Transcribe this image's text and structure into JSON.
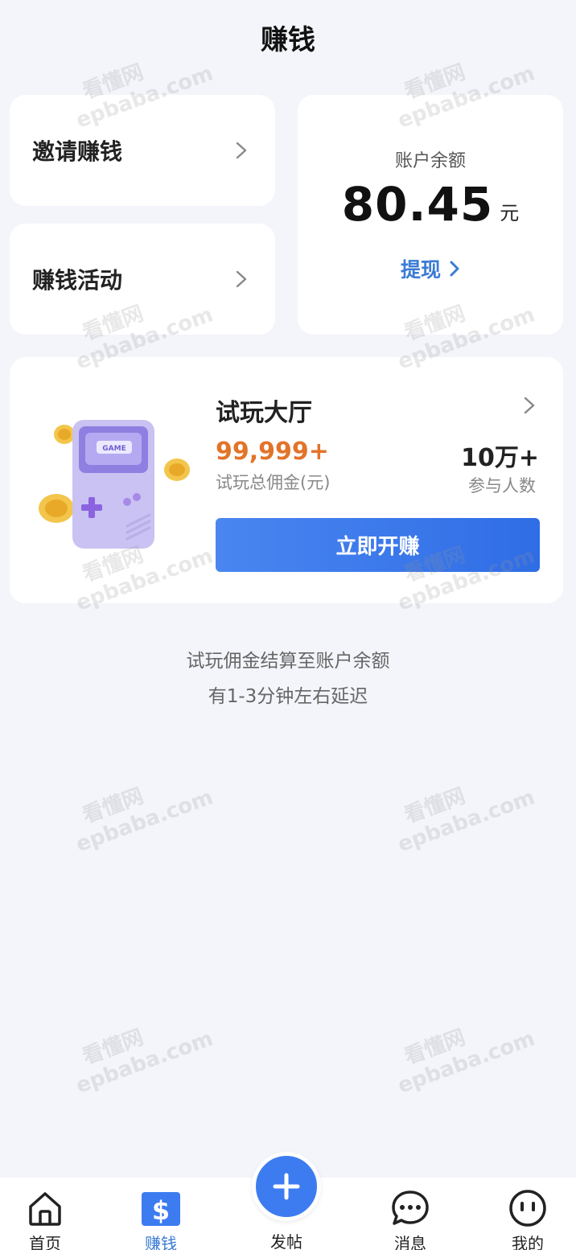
{
  "header": {
    "title": "赚钱"
  },
  "invite": {
    "label": "邀请赚钱"
  },
  "activity": {
    "label": "赚钱活动"
  },
  "balance": {
    "label": "账户余额",
    "amount": "80.45",
    "unit": "元",
    "withdraw_label": "提现"
  },
  "trial": {
    "title": "试玩大厅",
    "commission_value": "99,999+",
    "commission_label": "试玩总佣金(元)",
    "people_value": "10万+",
    "people_label": "参与人数",
    "button_label": "立即开赚",
    "illustration_text": "GAME"
  },
  "notes": {
    "line1": "试玩佣金结算至账户余额",
    "line2": "有1-3分钟左右延迟"
  },
  "watermark": {
    "line1": "看懂网",
    "line2": "epbaba.com"
  },
  "tabbar": {
    "home": "首页",
    "earn": "赚钱",
    "post": "发帖",
    "messages": "消息",
    "me": "我的"
  },
  "colors": {
    "accent": "#3a7bd5",
    "orange": "#e2742a",
    "background": "#f3f5fa"
  }
}
